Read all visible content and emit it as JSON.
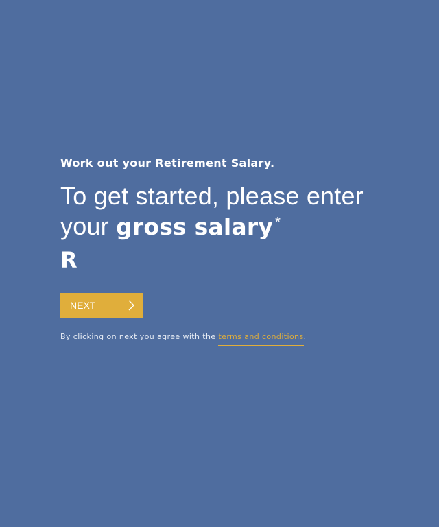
{
  "intro": {
    "eyebrow": "Work out your Retirement Salary.",
    "headline_part1": "To get started, please enter",
    "headline_part2": "your",
    "headline_bold": "gross salary",
    "asterisk": "*"
  },
  "salary": {
    "currency": "R",
    "value": "",
    "placeholder": ""
  },
  "actions": {
    "next_label": "NEXT",
    "next_icon": "chevron-right-icon"
  },
  "legal": {
    "prefix": "By clicking on next you agree with the",
    "link_text": "terms and conditions",
    "suffix": "."
  },
  "colors": {
    "background": "#4f6d9f",
    "accent": "#e0ae3b",
    "text": "#ffffff"
  }
}
